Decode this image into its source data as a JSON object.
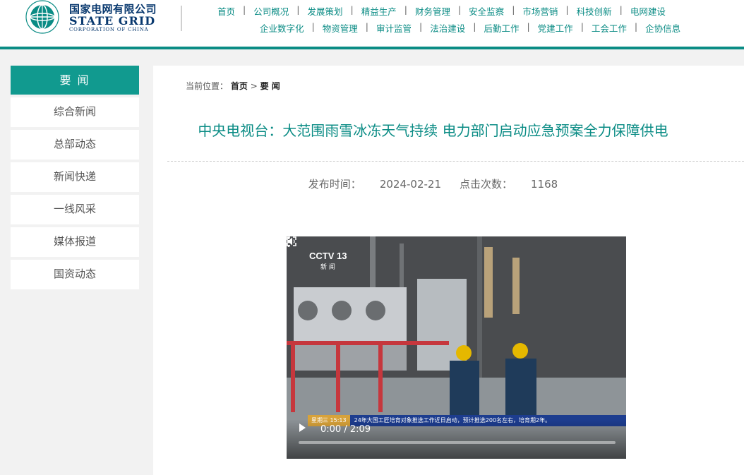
{
  "header": {
    "brand_cn": "国家电网有限公司",
    "brand_en": "STATE GRID",
    "brand_sub": "CORPORATION OF CHINA",
    "nav_row1": [
      "首页",
      "公司概况",
      "发展策划",
      "精益生产",
      "财务管理",
      "安全监察",
      "市场营销",
      "科技创新",
      "电网建设"
    ],
    "nav_row2": [
      "企业数字化",
      "物资管理",
      "审计监管",
      "法治建设",
      "后勤工作",
      "党建工作",
      "工会工作",
      "企协信息"
    ],
    "separator": "|"
  },
  "sidebar": {
    "heading": "要 闻",
    "items": [
      "综合新闻",
      "总部动态",
      "新闻快递",
      "一线风采",
      "媒体报道",
      "国资动态"
    ]
  },
  "breadcrumb": {
    "prefix": "当前位置：",
    "home": "首页",
    "sep": ">",
    "current": "要 闻"
  },
  "article": {
    "title": "中央电视台：大范围雨雪冰冻天气持续 电力部门启动应急预案全力保障供电",
    "publish_label": "发布时间：",
    "publish_date": "2024-02-21",
    "views_label": "点击次数：",
    "views": "1168"
  },
  "video": {
    "time": "0:00 / 2:09",
    "channel_logo": "CCTV 13",
    "channel_sub": "新 闻",
    "ticker_tag": "星期三 15:13",
    "ticker_text": "24年大国工匠培育对象推选工作近日启动，预计推选200名左右，培育期2年。"
  },
  "colors": {
    "brand_teal": "#0b8c85",
    "sidebar_active": "#119a8f",
    "brand_navy": "#08386e"
  },
  "icons": [
    "state-grid-logo-icon",
    "play-icon",
    "volume-icon",
    "fullscreen-icon",
    "more-options-icon"
  ]
}
